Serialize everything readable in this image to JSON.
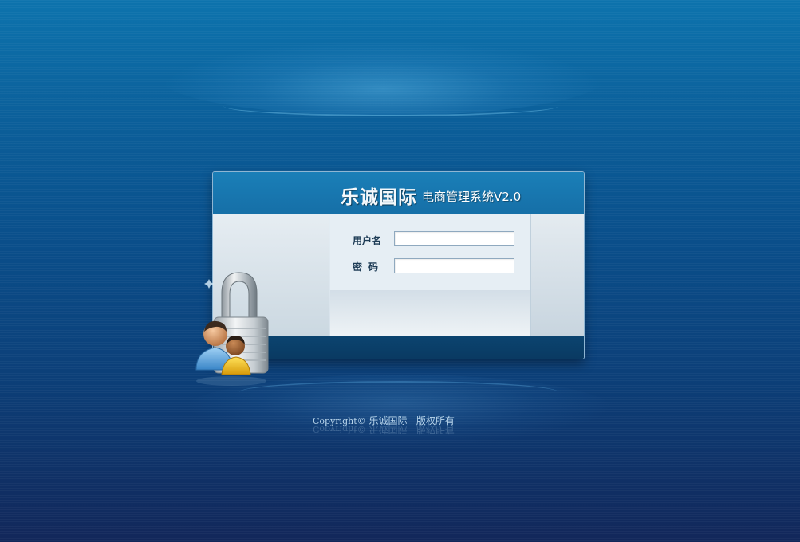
{
  "header": {
    "brand": "乐诚国际",
    "subtitle": "电商管理系统V2.0"
  },
  "login_form": {
    "username_label": "用户名",
    "password_label": "密码",
    "username_value": "",
    "password_value": ""
  },
  "footer": {
    "copyright_prefix": "Copyright©",
    "company": "乐诚国际",
    "rights": "版权所有"
  },
  "icons": {
    "lock": "lock-users-icon"
  },
  "colors": {
    "header_blue": "#166fa7",
    "footer_bar": "#0a3a62",
    "label_text": "#1d3b55"
  }
}
